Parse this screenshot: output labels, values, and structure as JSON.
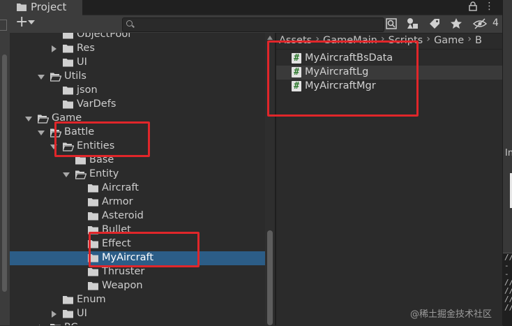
{
  "window": {
    "tab_title": "Project",
    "tab_menu": "⋮",
    "eye_count": "4"
  },
  "toolbar": {
    "add_label": "+",
    "search_value": "",
    "search_placeholder": ""
  },
  "tree": {
    "rows": [
      {
        "label": "ObjectPool",
        "depth": 4,
        "arrow": "none",
        "icon": "folder-closed"
      },
      {
        "label": "Res",
        "depth": 4,
        "arrow": "collapsed",
        "icon": "folder-closed"
      },
      {
        "label": "UI",
        "depth": 4,
        "arrow": "none",
        "icon": "folder-closed"
      },
      {
        "label": "Utils",
        "depth": 3,
        "arrow": "expanded",
        "icon": "folder-open"
      },
      {
        "label": "json",
        "depth": 4,
        "arrow": "none",
        "icon": "folder-closed"
      },
      {
        "label": "VarDefs",
        "depth": 4,
        "arrow": "none",
        "icon": "folder-closed"
      },
      {
        "label": "Game",
        "depth": 2,
        "arrow": "expanded",
        "icon": "folder-open"
      },
      {
        "label": "Battle",
        "depth": 3,
        "arrow": "expanded",
        "icon": "folder-open"
      },
      {
        "label": "Entities",
        "depth": 4,
        "arrow": "expanded",
        "icon": "folder-open"
      },
      {
        "label": "Base",
        "depth": 5,
        "arrow": "none",
        "icon": "folder-closed"
      },
      {
        "label": "Entity",
        "depth": 5,
        "arrow": "expanded",
        "icon": "folder-open"
      },
      {
        "label": "Aircraft",
        "depth": 6,
        "arrow": "none",
        "icon": "folder-closed"
      },
      {
        "label": "Armor",
        "depth": 6,
        "arrow": "none",
        "icon": "folder-closed"
      },
      {
        "label": "Asteroid",
        "depth": 6,
        "arrow": "none",
        "icon": "folder-closed"
      },
      {
        "label": "Bullet",
        "depth": 6,
        "arrow": "none",
        "icon": "folder-closed"
      },
      {
        "label": "Effect",
        "depth": 6,
        "arrow": "none",
        "icon": "folder-closed"
      },
      {
        "label": "MyAircraft",
        "depth": 6,
        "arrow": "none",
        "icon": "folder-closed",
        "selected": true
      },
      {
        "label": "Thruster",
        "depth": 6,
        "arrow": "none",
        "icon": "folder-closed"
      },
      {
        "label": "Weapon",
        "depth": 6,
        "arrow": "none",
        "icon": "folder-closed"
      },
      {
        "label": "Enum",
        "depth": 4,
        "arrow": "none",
        "icon": "folder-closed"
      },
      {
        "label": "UI",
        "depth": 4,
        "arrow": "collapsed",
        "icon": "folder-closed"
      },
      {
        "label": "RC",
        "depth": 3,
        "arrow": "collapsed",
        "icon": "folder-closed"
      }
    ]
  },
  "breadcrumb": [
    "Assets",
    "GameMain",
    "Scripts",
    "Game",
    "B"
  ],
  "breadcrumb_separator": "›",
  "files": [
    {
      "label": "MyAircraftBsData",
      "icon": "csharp-script-icon"
    },
    {
      "label": "MyAircraftLg",
      "icon": "csharp-script-icon",
      "hover": true
    },
    {
      "label": "MyAircraftMgr",
      "icon": "csharp-script-icon"
    }
  ],
  "file_icon_glyph": "#",
  "right_panel": {
    "inspector_label": "In",
    "lock": "🔒",
    "code_lines": [
      "//",
      "--",
      "//",
      "//",
      "//",
      "//"
    ]
  },
  "watermark": "@稀土掘金技术社区",
  "colors": {
    "selection": "#2c5d87",
    "annotation": "#e0262a",
    "background": "#2b2b2b"
  }
}
